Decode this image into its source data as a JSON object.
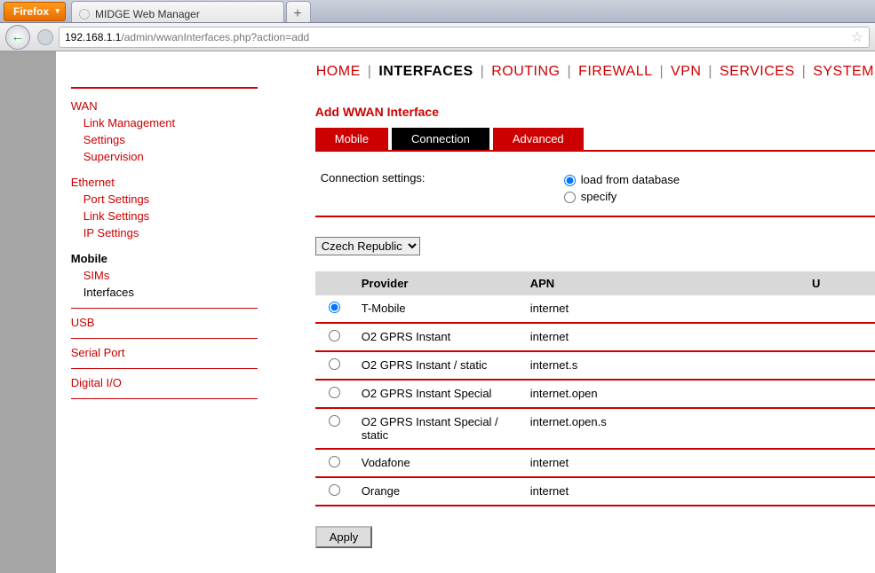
{
  "browser": {
    "app_button": "Firefox",
    "tab_title": "MIDGE Web Manager",
    "newtab": "+",
    "url_host": "192.168.1.1",
    "url_path": "/admin/wwanInterfaces.php?action=add"
  },
  "topnav": {
    "items": [
      "HOME",
      "INTERFACES",
      "ROUTING",
      "FIREWALL",
      "VPN",
      "SERVICES",
      "SYSTEM"
    ],
    "active_index": 1,
    "sep": "|"
  },
  "sidebar": {
    "wan": {
      "label": "WAN",
      "items": [
        "Link Management",
        "Settings",
        "Supervision"
      ]
    },
    "ethernet": {
      "label": "Ethernet",
      "items": [
        "Port Settings",
        "Link Settings",
        "IP Settings"
      ]
    },
    "mobile": {
      "label": "Mobile",
      "items": [
        "SIMs",
        "Interfaces"
      ],
      "active_item_index": 1
    },
    "usb": {
      "label": "USB"
    },
    "serial": {
      "label": "Serial Port"
    },
    "digital": {
      "label": "Digital I/O"
    }
  },
  "page": {
    "title": "Add WWAN Interface",
    "tabs": [
      "Mobile",
      "Connection",
      "Advanced"
    ],
    "active_tab_index": 1,
    "conn_label": "Connection settings:",
    "conn_opt_load": "load from database",
    "conn_opt_specify": "specify",
    "country_selected": "Czech Republic",
    "table_headers": {
      "provider": "Provider",
      "apn": "APN",
      "user": "U"
    },
    "providers": [
      {
        "name": "T-Mobile",
        "apn": "internet",
        "selected": true
      },
      {
        "name": "O2 GPRS Instant",
        "apn": "internet"
      },
      {
        "name": "O2 GPRS Instant / static",
        "apn": "internet.s"
      },
      {
        "name": "O2 GPRS Instant Special",
        "apn": "internet.open"
      },
      {
        "name": "O2 GPRS Instant Special / static",
        "apn": "internet.open.s"
      },
      {
        "name": "Vodafone",
        "apn": "internet"
      },
      {
        "name": "Orange",
        "apn": "internet"
      }
    ],
    "apply_label": "Apply"
  }
}
